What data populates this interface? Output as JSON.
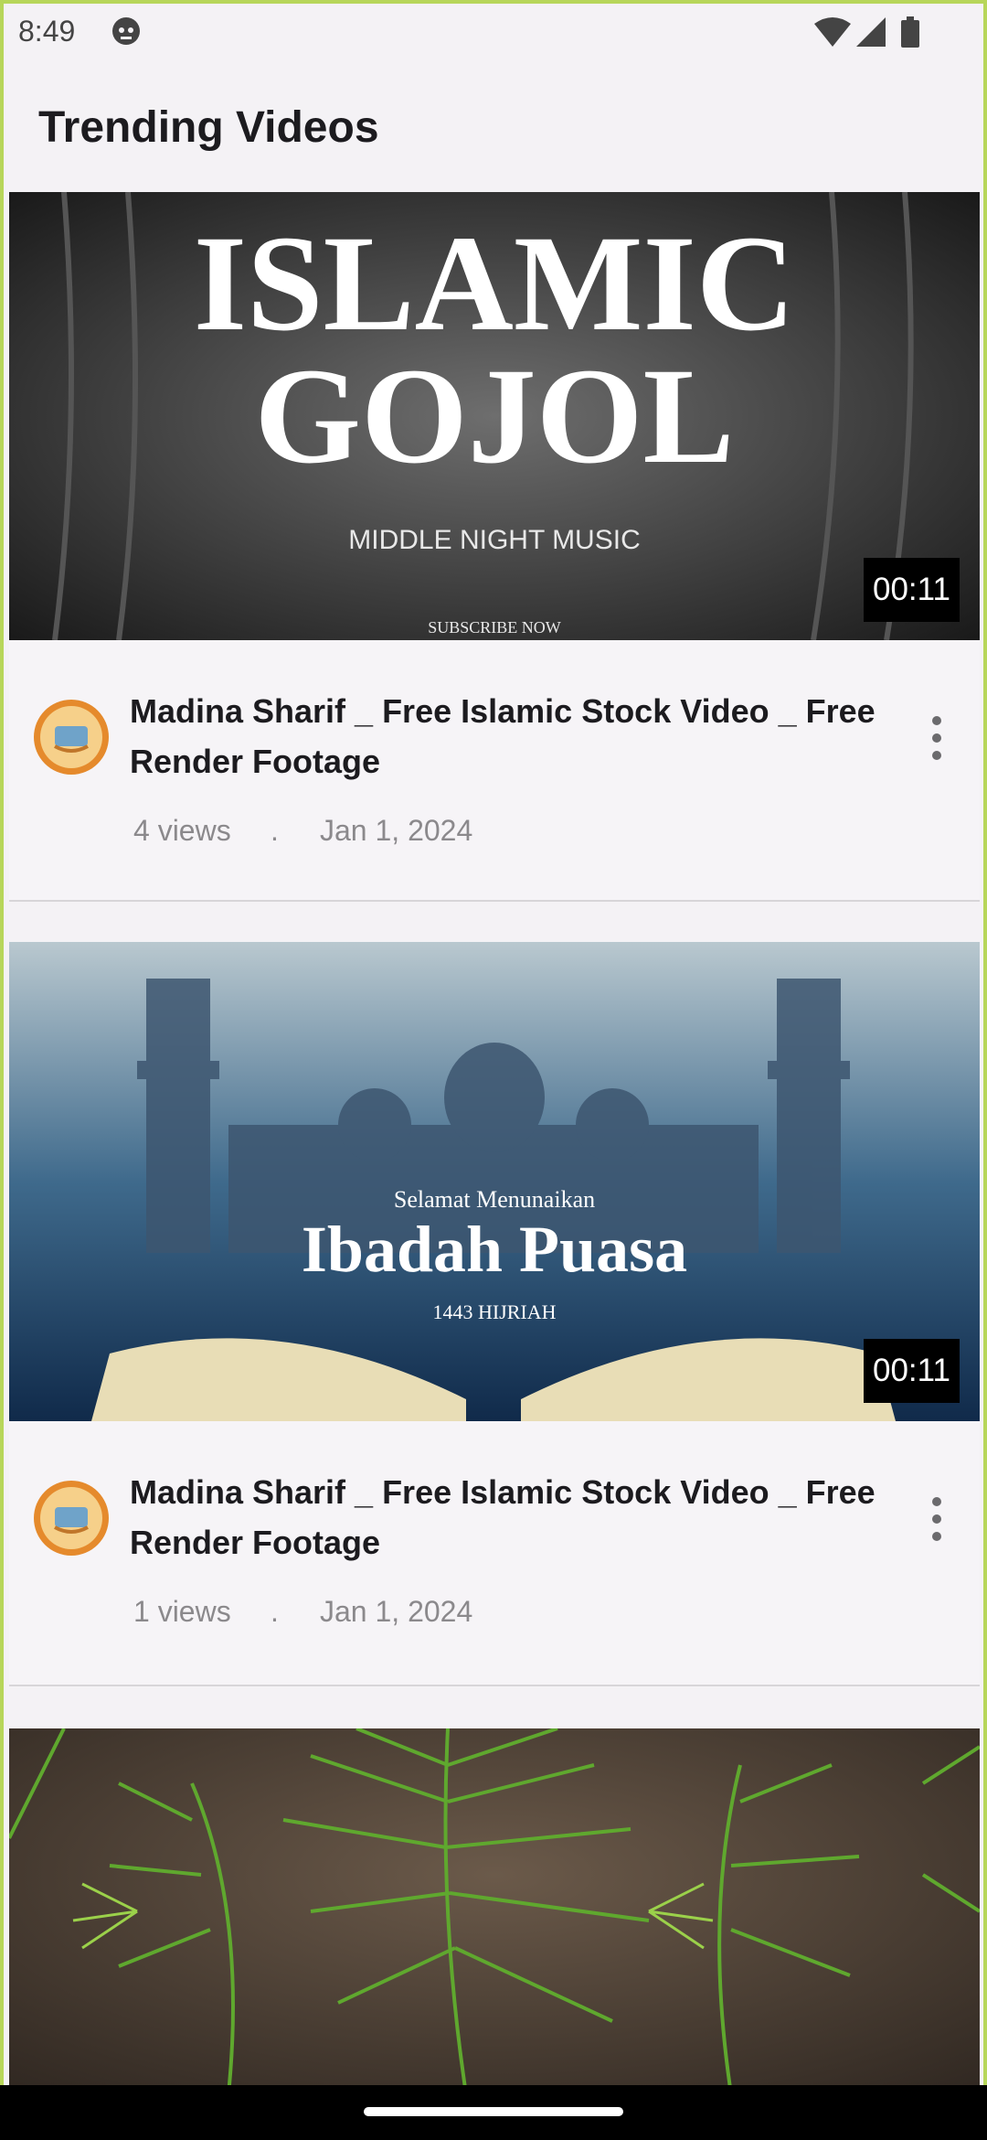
{
  "status_bar": {
    "time": "8:49",
    "icons": [
      "robot-icon",
      "wifi-icon",
      "signal-icon",
      "battery-icon"
    ]
  },
  "page": {
    "title": "Trending Videos"
  },
  "videos": [
    {
      "thumbnail": {
        "line1": "ISLAMIC",
        "line2": "GOJOL",
        "line3": "MIDDLE NIGHT MUSIC",
        "line4": "SUBSCRIBE NOW"
      },
      "duration": "00:11",
      "title": "Madina Sharif _ Free Islamic Stock Video _ Free Render Footage",
      "views": "4 views",
      "separator": ".",
      "date": "Jan 1, 2024"
    },
    {
      "thumbnail": {
        "line1": "Selamat Menunaikan",
        "line2": "Ibadah Puasa",
        "line3": "1443 HIJRIAH"
      },
      "duration": "00:11",
      "title": "Madina Sharif _ Free Islamic Stock Video _ Free Render Footage",
      "views": "1 views",
      "separator": ".",
      "date": "Jan 1, 2024"
    },
    {
      "thumbnail": {}
    }
  ],
  "colors": {
    "background": "#f4f2f5",
    "text": "#1c1b1f",
    "meta_text": "#8b898c",
    "frame": "#b7d65a"
  }
}
